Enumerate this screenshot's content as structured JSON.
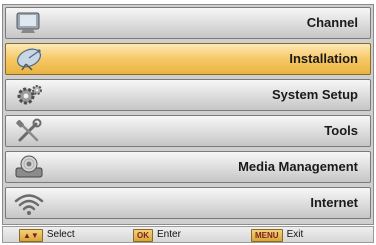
{
  "menu": {
    "items": [
      {
        "label": "Channel",
        "icon": "tv-screen-icon"
      },
      {
        "label": "Installation",
        "icon": "satellite-dish-icon"
      },
      {
        "label": "System Setup",
        "icon": "gears-icon"
      },
      {
        "label": "Tools",
        "icon": "tools-icon"
      },
      {
        "label": "Media Management",
        "icon": "media-disc-icon"
      },
      {
        "label": "Internet",
        "icon": "wifi-icon"
      }
    ],
    "selected_index": 1
  },
  "footer": {
    "select": {
      "key": "▲▼",
      "label": "Select"
    },
    "enter": {
      "key": "OK",
      "label": "Enter"
    },
    "exit": {
      "key": "MENU",
      "label": "Exit"
    }
  },
  "colors": {
    "selected_item": "#f6c865",
    "item": "#dcdcdc",
    "key_badge": "#d9a539"
  }
}
